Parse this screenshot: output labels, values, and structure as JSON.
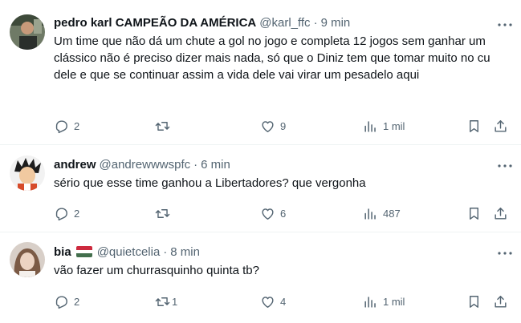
{
  "tweets": [
    {
      "name": "pedro karl CAMPEÃO DA AMÉRICA",
      "handle": "@karl_ffc",
      "separator": "·",
      "time": "9 min",
      "text": "Um time que não dá um chute a gol no jogo e completa 12 jogos sem ganhar um clássico não é preciso dizer mais nada, só que o Diniz tem que tomar muito no cu dele e que se continuar assim a vida dele vai virar um pesadelo aqui",
      "replies": "2",
      "retweets": "",
      "likes": "9",
      "views": "1 mil"
    },
    {
      "name": "andrew",
      "handle": "@andrewwwspfc",
      "separator": "·",
      "time": "6 min",
      "text": "sério que esse time ganhou a Libertadores? que vergonha",
      "replies": "2",
      "retweets": "",
      "likes": "6",
      "views": "487"
    },
    {
      "name": "bia",
      "handle": "@quietcelia",
      "separator": "·",
      "time": "8 min",
      "text": "vão fazer um churrasquinho quinta tb?",
      "replies": "2",
      "retweets": "1",
      "likes": "4",
      "views": "1 mil",
      "flag_colors": [
        "#cd2a3e",
        "#ffffff",
        "#436f4d"
      ]
    }
  ],
  "icons": {
    "reply": "reply-icon",
    "retweet": "retweet-icon",
    "like": "heart-icon",
    "views": "views-icon",
    "bookmark": "bookmark-icon",
    "share": "share-icon",
    "more": "more-icon"
  },
  "colors": {
    "text": "#0f1419",
    "secondary": "#536471",
    "divider": "#eff3f4"
  }
}
